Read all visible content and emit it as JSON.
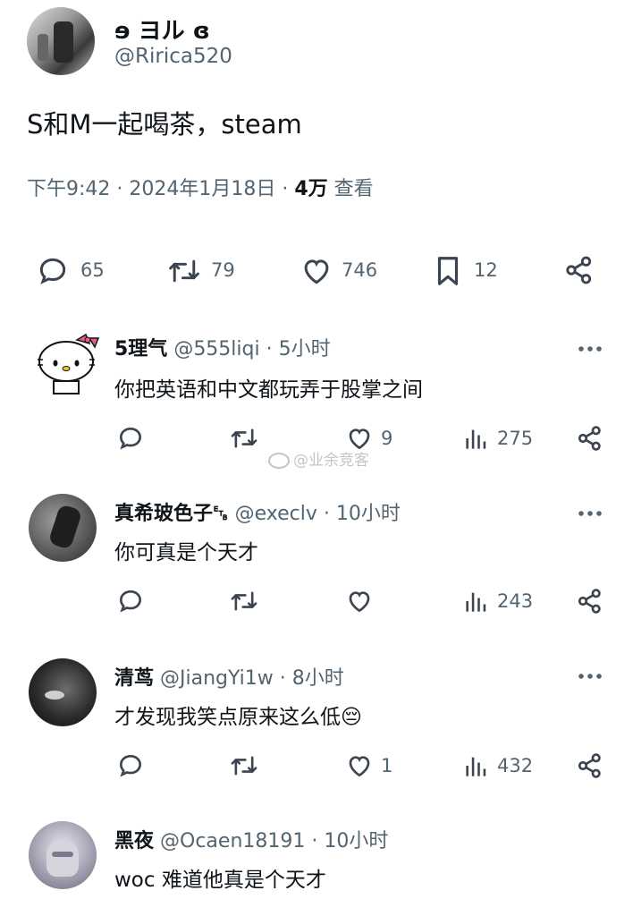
{
  "tweet": {
    "display_name": "ɘ ヨル ɞ",
    "handle": "@Ririca520",
    "text": "S和M一起喝茶，steam",
    "time": "下午9:42 · 2024年1月18日 · ",
    "views_count": "4万",
    "views_label": " 查看",
    "actions": {
      "replies": "65",
      "retweets": "79",
      "likes": "746",
      "bookmarks": "12"
    }
  },
  "watermark": "@业余竞客",
  "replies": [
    {
      "display_name": "5理气",
      "handle": "@555liqi",
      "dot": " · ",
      "time": "5小时",
      "text": "你把英语和中文都玩弄于股掌之间",
      "likes": "9",
      "views": "275"
    },
    {
      "display_name": "真希玻色子␗",
      "handle": "@execlv",
      "dot": " · ",
      "time": "10小时",
      "text": "你可真是个天才",
      "likes": "",
      "views": "243"
    },
    {
      "display_name": "清茑",
      "handle": "@JiangYi1w",
      "dot": " · ",
      "time": "8小时",
      "text": "才发现我笑点原来这么低",
      "emoji": "😔",
      "likes": "1",
      "views": "432"
    },
    {
      "display_name": "黑夜",
      "handle": "@Ocaen18191",
      "dot": " · ",
      "time": "10小时",
      "text": "woc 难道他真是个天才"
    }
  ],
  "icons": {
    "reply": "speech-bubble-icon",
    "retweet": "retweet-icon",
    "like": "heart-icon",
    "bookmark": "bookmark-icon",
    "share": "share-icon",
    "views": "bar-chart-icon",
    "more": "more-dots-icon"
  }
}
